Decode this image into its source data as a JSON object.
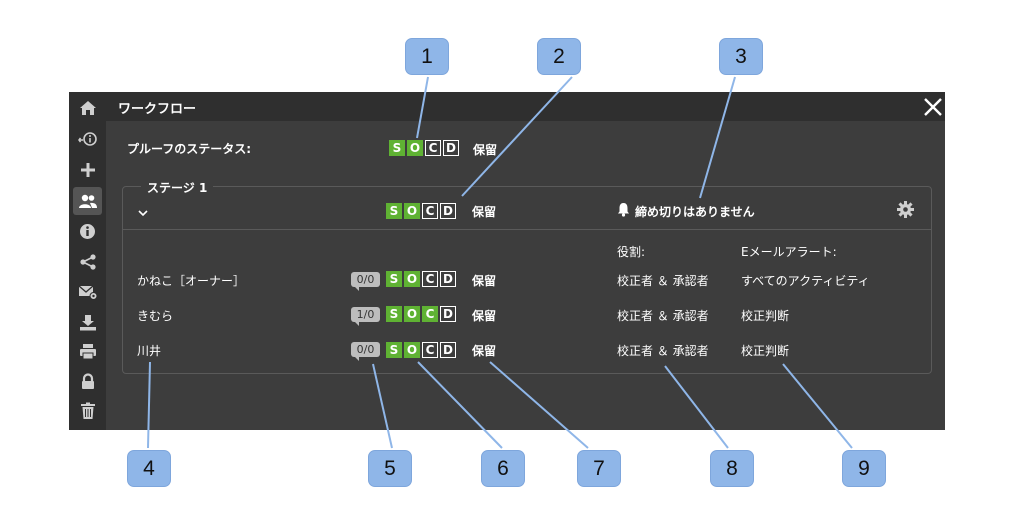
{
  "window": {
    "title": "ワークフロー"
  },
  "proof_status": {
    "label": "プルーフのステータス:",
    "badges": [
      "S",
      "O",
      "C",
      "D"
    ],
    "status": "保留"
  },
  "stage": {
    "legend": "ステージ 1",
    "badges": [
      "S",
      "O",
      "C",
      "D"
    ],
    "status": "保留",
    "deadline": "締め切りはありません",
    "column_role": "役割:",
    "column_email": "Eメールアラート:"
  },
  "participants": [
    {
      "name": "かねこ［オーナー］",
      "count": "0/0",
      "status": "保留",
      "role": "校正者 ＆ 承認者",
      "alert": "すべてのアクティビティ"
    },
    {
      "name": "きむら",
      "count": "1/0",
      "status": "保留",
      "role": "校正者 ＆ 承認者",
      "alert": "校正判断"
    },
    {
      "name": "川井",
      "count": "0/0",
      "status": "保留",
      "role": "校正者 ＆ 承認者",
      "alert": "校正判断"
    }
  ],
  "sidebar_icons": [
    "home-icon",
    "info-back-icon",
    "plus-icon",
    "users-icon",
    "info-icon",
    "share-icon",
    "mail-settings-icon",
    "download-icon",
    "print-icon",
    "lock-icon",
    "trash-icon"
  ],
  "callouts": [
    "1",
    "2",
    "3",
    "4",
    "5",
    "6",
    "7",
    "8",
    "9"
  ],
  "colors": {
    "accent_green": "#5fb233",
    "callout_blue": "#8fb6e8",
    "panel_bg": "#3d3d3d",
    "sidebar_bg": "#2f2f2f"
  }
}
